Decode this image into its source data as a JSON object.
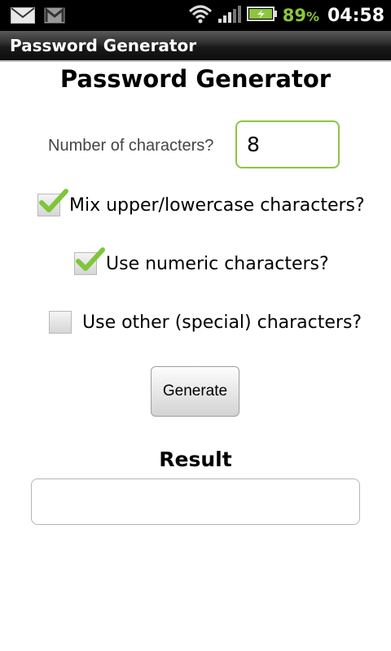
{
  "status_bar": {
    "icons": [
      "mail-icon",
      "gmail-icon",
      "wifi-icon",
      "signal-icon",
      "battery-icon"
    ],
    "battery_number": "89",
    "battery_unit": "%",
    "time": "04:58",
    "accent": "#8cc63f"
  },
  "app_bar": {
    "title": "Password Generator"
  },
  "main": {
    "heading": "Password Generator",
    "num_chars": {
      "label": "Number of characters?",
      "value": "8"
    },
    "options": [
      {
        "label": "Mix upper/lowercase characters?",
        "checked": true
      },
      {
        "label": "Use numeric characters?",
        "checked": true
      },
      {
        "label": "Use other (special) characters?",
        "checked": false
      }
    ],
    "generate_label": "Generate",
    "result_heading": "Result",
    "result_value": ""
  }
}
